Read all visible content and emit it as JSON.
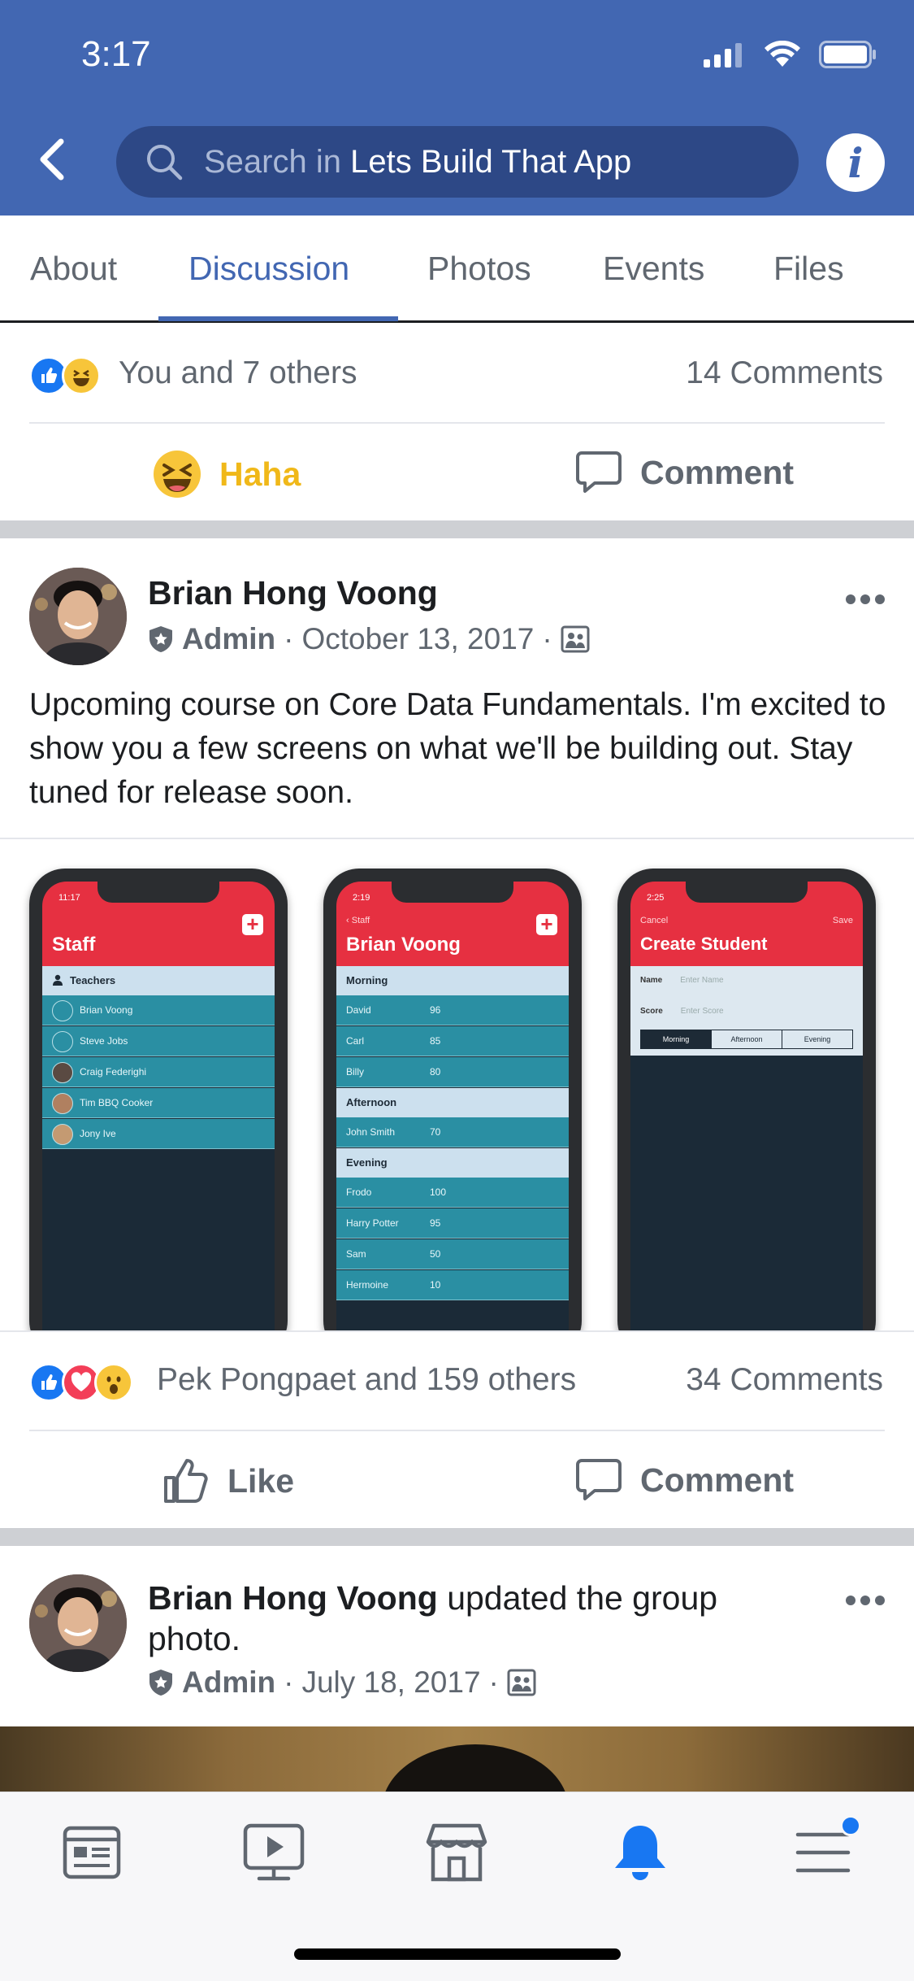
{
  "status_bar": {
    "time": "3:17"
  },
  "header": {
    "search_prefix": "Search in ",
    "search_group": "Lets Build That App",
    "info_glyph": "i",
    "colors": {
      "brand": "#4267b2"
    }
  },
  "tabs": [
    {
      "label": "About",
      "active": false
    },
    {
      "label": "Discussion",
      "active": true
    },
    {
      "label": "Photos",
      "active": false
    },
    {
      "label": "Events",
      "active": false
    },
    {
      "label": "Files",
      "active": false
    }
  ],
  "top_post": {
    "reactions_text": "You and 7 others",
    "comments_text": "14 Comments",
    "reaction_icons": [
      "like-icon",
      "haha-icon"
    ],
    "actions": {
      "reaction_label": "Haha",
      "comment_label": "Comment"
    }
  },
  "post1": {
    "author": "Brian Hong Voong",
    "role": "Admin",
    "date": "October 13, 2017",
    "separator": "·",
    "text": "Upcoming course on Core Data Fundamentals.  I'm excited to show you a few screens on what we'll be building out. Stay tuned for release soon.",
    "phones": [
      {
        "time": "11:17",
        "title": "Staff",
        "section": "Teachers",
        "rows": [
          "Brian Voong",
          "Steve Jobs",
          "Craig Federighi",
          "Tim BBQ Cooker",
          "Jony Ive"
        ]
      },
      {
        "time": "2:19",
        "back": "Staff",
        "title": "Brian Voong",
        "sections": [
          {
            "name": "Morning",
            "rows": [
              [
                "David",
                "96"
              ],
              [
                "Carl",
                "85"
              ],
              [
                "Billy",
                "80"
              ]
            ]
          },
          {
            "name": "Afternoon",
            "rows": [
              [
                "John Smith",
                "70"
              ]
            ]
          },
          {
            "name": "Evening",
            "rows": [
              [
                "Frodo",
                "100"
              ],
              [
                "Harry Potter",
                "95"
              ],
              [
                "Sam",
                "50"
              ],
              [
                "Hermoine",
                "10"
              ]
            ]
          }
        ]
      },
      {
        "time": "2:25",
        "cancel": "Cancel",
        "save": "Save",
        "title": "Create Student",
        "name_label": "Name",
        "name_placeholder": "Enter Name",
        "score_label": "Score",
        "score_placeholder": "Enter Score",
        "segments": [
          "Morning",
          "Afternoon",
          "Evening"
        ]
      }
    ],
    "reactions_text": "Pek Pongpaet and 159 others",
    "comments_text": "34 Comments",
    "reaction_icons": [
      "like-icon",
      "love-icon",
      "wow-icon"
    ],
    "actions": {
      "like_label": "Like",
      "comment_label": "Comment"
    }
  },
  "post2": {
    "author": "Brian Hong Voong",
    "action_text": " updated the group",
    "action_text2": "photo.",
    "role": "Admin",
    "date": "July 18, 2017",
    "separator": "·"
  },
  "bottom_nav": [
    {
      "icon": "news-feed-icon"
    },
    {
      "icon": "watch-icon"
    },
    {
      "icon": "marketplace-icon"
    },
    {
      "icon": "notifications-icon",
      "active": true
    },
    {
      "icon": "menu-icon",
      "badge": true
    }
  ]
}
